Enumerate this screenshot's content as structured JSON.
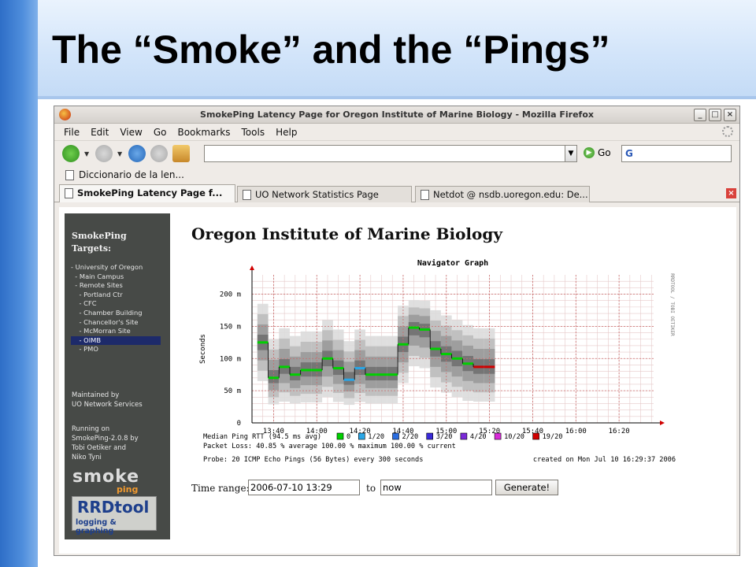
{
  "slide": {
    "title": "The “Smoke” and the “Pings”"
  },
  "window": {
    "title": "SmokePing Latency Page for Oregon Institute of Marine Biology - Mozilla Firefox"
  },
  "menu": [
    "File",
    "Edit",
    "View",
    "Go",
    "Bookmarks",
    "Tools",
    "Help"
  ],
  "nav": {
    "go_label": "Go",
    "url_value": "",
    "search_engine": "G"
  },
  "bookmarks": [
    {
      "label": "Diccionario de la len..."
    }
  ],
  "tabs": [
    {
      "label": "SmokePing Latency Page f...",
      "active": true
    },
    {
      "label": "UO Network Statistics Page",
      "active": false
    },
    {
      "label": "Netdot @ nsdb.uoregon.edu: De...",
      "active": false
    }
  ],
  "sidebar": {
    "title_line1": "SmokePing",
    "title_line2": "Targets:",
    "tree": [
      "- University of Oregon",
      "  - Main Campus",
      "  - Remote Sites",
      "    - Portland Ctr",
      "    - CFC",
      "    - Chamber Building",
      "    - Chancellor's Site",
      "    - McMorran Site",
      "    - OIMB",
      "    - PMO"
    ],
    "selected_index": 8,
    "maintained_1": "Maintained by",
    "maintained_2": "UO Network Services",
    "running_1": "Running on",
    "running_2": "SmokePing-2.0.8 by",
    "running_3": "Tobi Oetiker and",
    "running_4": "Niko Tyni",
    "logo_smoke": "smoke",
    "logo_ping": "ping",
    "logo_rrd": "RRDtool",
    "logo_rrd_sub": "logging & graphing"
  },
  "page": {
    "heading": "Oregon Institute of Marine Biology"
  },
  "chart_data": {
    "type": "line",
    "title": "Navigator Graph",
    "ylabel": "Seconds",
    "side_label": "RRDTOOL / TOBI OETIKER",
    "ylim": [
      0,
      230
    ],
    "yticks": [
      0,
      50,
      100,
      150,
      200
    ],
    "ytick_labels": [
      "0",
      "50 m",
      "100 m",
      "150 m",
      "200 m"
    ],
    "xtick_labels": [
      "13:40",
      "14:00",
      "14:20",
      "14:40",
      "15:00",
      "15:20",
      "15:40",
      "16:00",
      "16:20"
    ],
    "x_range_minutes": [
      13.5,
      16.6
    ],
    "series": [
      {
        "name": "Median Ping RTT",
        "x": [
          "13:35",
          "13:40",
          "13:45",
          "13:50",
          "13:55",
          "14:00",
          "14:05",
          "14:10",
          "14:15",
          "14:20",
          "14:25",
          "14:30",
          "14:35",
          "14:40",
          "14:45",
          "14:50",
          "14:55",
          "15:00",
          "15:05",
          "15:10",
          "15:15",
          "15:20"
        ],
        "values": [
          125,
          70,
          87,
          75,
          82,
          82,
          100,
          85,
          67,
          85,
          75,
          75,
          75,
          122,
          148,
          145,
          115,
          107,
          100,
          92,
          87,
          87
        ],
        "loss_colors": [
          "#00d000",
          "#00d000",
          "#00d000",
          "#00d000",
          "#00d000",
          "#00d000",
          "#00d000",
          "#00d000",
          "#2aa6e6",
          "#2aa6e6",
          "#00d000",
          "#00d000",
          "#00d000",
          "#00d000",
          "#00d000",
          "#00d000",
          "#00d000",
          "#00d000",
          "#00d000",
          "#00d000",
          "#d00000",
          "#d00000"
        ]
      }
    ],
    "legend": {
      "label": "Median Ping RTT (94.5 ms avg)",
      "items": [
        {
          "label": "0",
          "color": "#00d000"
        },
        {
          "label": "1/20",
          "color": "#2aa6e6"
        },
        {
          "label": "2/20",
          "color": "#2a6de0"
        },
        {
          "label": "3/20",
          "color": "#3a2ad8"
        },
        {
          "label": "4/20",
          "color": "#7a2ad8"
        },
        {
          "label": "10/20",
          "color": "#d82ad8"
        },
        {
          "label": "19/20",
          "color": "#d00000"
        }
      ]
    },
    "packet_loss_text": "Packet Loss: 40.85 % average  100.00 % maximum  100.00 % current",
    "probe_text": "Probe: 20 ICMP Echo Pings (56 Bytes) every 300 seconds",
    "created_text": "created on Mon Jul 10 16:29:37 2006",
    "grid": true
  },
  "form": {
    "time_range_label": "Time range:",
    "from_value": "2006-07-10 13:29",
    "to_label": "to",
    "to_value": "now",
    "generate_label": "Generate!"
  }
}
